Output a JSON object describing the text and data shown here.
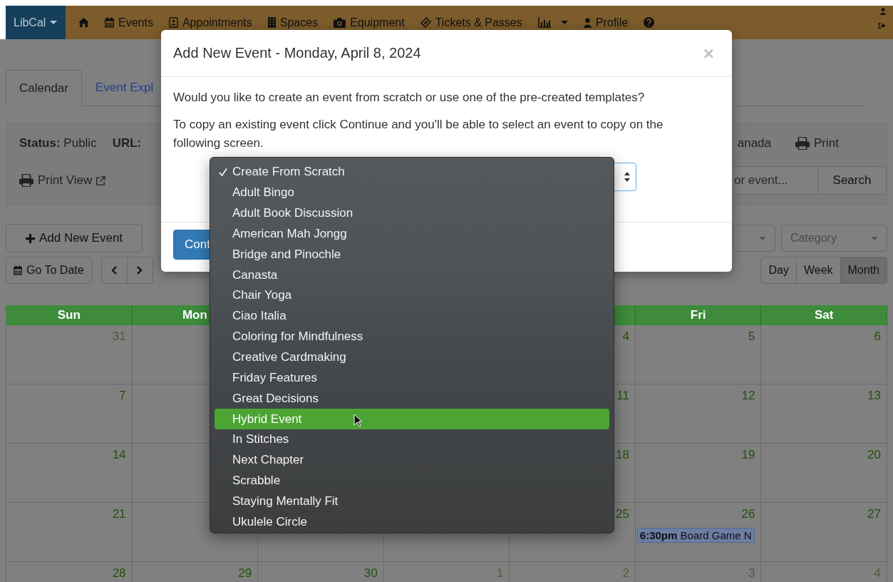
{
  "navbar": {
    "brand": {
      "label": "LibCal",
      "dropdown": true
    },
    "items": [
      {
        "dropdown": false
      },
      {
        "label": "Events",
        "dropdown": false
      },
      {
        "label": "Appointments",
        "dropdown": false
      },
      {
        "label": "Spaces",
        "dropdown": false
      },
      {
        "label": "Equipment",
        "dropdown": false
      },
      {
        "label": "Tickets & Passes",
        "dropdown": false
      },
      {
        "dropdown": true
      },
      {
        "label": "Profile",
        "dropdown": false
      },
      {
        "dropdown": false
      }
    ]
  },
  "tabs": [
    {
      "label": "Calendar",
      "selected": true
    },
    {
      "label": "Event Expl",
      "selected": false
    }
  ],
  "info_panel": {
    "status_label": "Status:",
    "status_value": "Public",
    "url_label": "URL:",
    "location_fragment": "anada",
    "print": "Print",
    "print_view": "Print View",
    "search": {
      "placeholder": "or event...",
      "button": "Search"
    }
  },
  "toolbar": {
    "add_event": "Add New Event",
    "go_to_date": "Go To Date",
    "category_filter": {
      "placeholder": "Category"
    },
    "views": [
      {
        "label": "Day",
        "selected": false
      },
      {
        "label": "Week",
        "selected": false
      },
      {
        "label": "Month",
        "selected": true
      }
    ]
  },
  "calendar": {
    "weekdays": {
      "sun": "Sun",
      "mon": "Mon",
      "fri": "Fri",
      "sat": "Sat"
    },
    "weeks": [
      {
        "sun": {
          "day": "31",
          "other_month": true
        },
        "thu": {
          "day": "4",
          "other_month": false
        },
        "fri": {
          "day": "5",
          "other_month": false
        },
        "sat": {
          "day": "6",
          "other_month": false
        }
      },
      {
        "sun": {
          "day": "7",
          "other_month": false
        },
        "thu": {
          "day": "11",
          "other_month": false
        },
        "fri": {
          "day": "12",
          "other_month": false
        },
        "sat": {
          "day": "13",
          "other_month": false
        }
      },
      {
        "sun": {
          "day": "14",
          "other_month": false
        },
        "thu": {
          "day": "18",
          "other_month": false
        },
        "fri": {
          "day": "19",
          "other_month": false
        },
        "sat": {
          "day": "20",
          "other_month": false
        }
      },
      {
        "sun": {
          "day": "21",
          "other_month": false
        },
        "thu": {
          "day": "25",
          "other_month": false
        },
        "fri": {
          "day": "26",
          "other_month": false,
          "events": [
            {
              "time": "6:30pm",
              "title": "Board Game N"
            }
          ]
        },
        "sat": {
          "day": "27",
          "other_month": false
        }
      },
      {
        "sun": {
          "day": "28",
          "other_month": false
        },
        "mon": {
          "day": "29",
          "other_month": false
        },
        "tue": {
          "day": "30",
          "other_month": false
        },
        "wed": {
          "day": "1",
          "other_month": true
        },
        "thu": {
          "day": "2",
          "other_month": true
        },
        "fri": {
          "day": "3",
          "other_month": true
        },
        "sat": {
          "day": "4",
          "other_month": true
        }
      }
    ]
  },
  "modal": {
    "title": "Add New Event - Monday, April 8, 2024",
    "close": "×",
    "paragraphs": [
      "Would you like to create an event from scratch or use one of the pre-created templates?",
      "To copy an existing event click Continue and you'll be able to select an event to copy on the following screen."
    ],
    "continue_button": "Cont",
    "template_menu": [
      {
        "label": "Create From Scratch",
        "checked": true,
        "selected": false
      },
      {
        "label": "Adult Bingo",
        "checked": false,
        "selected": false
      },
      {
        "label": "Adult Book Discussion",
        "checked": false,
        "selected": false
      },
      {
        "label": "American Mah Jongg",
        "checked": false,
        "selected": false
      },
      {
        "label": "Bridge and Pinochle",
        "checked": false,
        "selected": false
      },
      {
        "label": "Canasta",
        "checked": false,
        "selected": false
      },
      {
        "label": "Chair Yoga",
        "checked": false,
        "selected": false
      },
      {
        "label": "Ciao Italia",
        "checked": false,
        "selected": false
      },
      {
        "label": "Coloring for Mindfulness",
        "checked": false,
        "selected": false
      },
      {
        "label": "Creative Cardmaking",
        "checked": false,
        "selected": false
      },
      {
        "label": "Friday Features",
        "checked": false,
        "selected": false
      },
      {
        "label": "Great Decisions",
        "checked": false,
        "selected": false
      },
      {
        "label": "Hybrid Event",
        "checked": false,
        "selected": true
      },
      {
        "label": "In Stitches",
        "checked": false,
        "selected": false
      },
      {
        "label": "Next Chapter",
        "checked": false,
        "selected": false
      },
      {
        "label": "Scrabble",
        "checked": false,
        "selected": false
      },
      {
        "label": "Staying Mentally Fit",
        "checked": false,
        "selected": false
      },
      {
        "label": "Ukulele Circle",
        "checked": false,
        "selected": false
      }
    ]
  }
}
